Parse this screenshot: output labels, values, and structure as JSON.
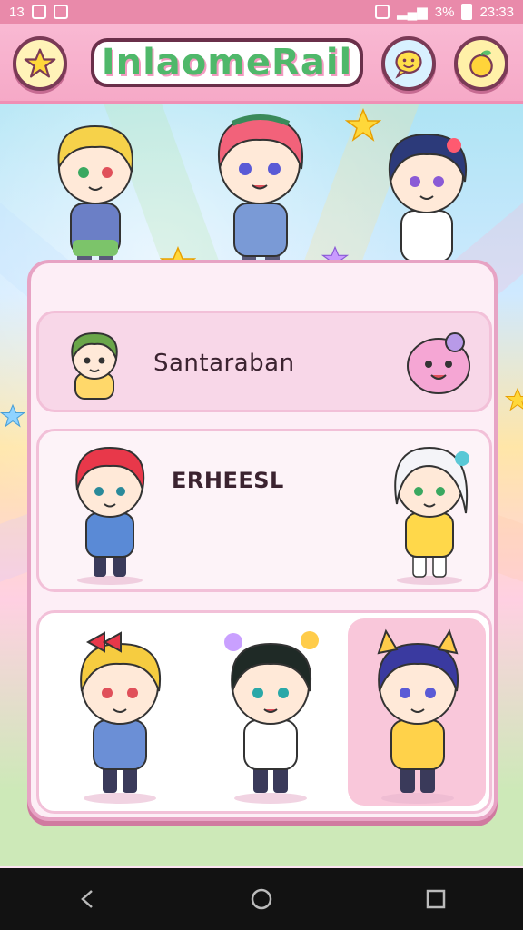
{
  "status_bar": {
    "time_left": "13",
    "battery_text": "3%",
    "time_right": "23:33"
  },
  "header": {
    "title": "InlaomeRail",
    "left_icon": "star-icon",
    "right_icons": [
      "chat-icon",
      "fruit-icon"
    ]
  },
  "cards": [
    {
      "label": "Santaraban"
    },
    {
      "label": "ERHEESL"
    },
    {
      "label": ""
    }
  ],
  "colors": {
    "accent_pink": "#f6a9c7",
    "panel": "#fdeef6",
    "border": "#e7a3c4"
  },
  "navbar": {
    "buttons": [
      "back-icon",
      "home-icon",
      "recents-icon"
    ]
  }
}
